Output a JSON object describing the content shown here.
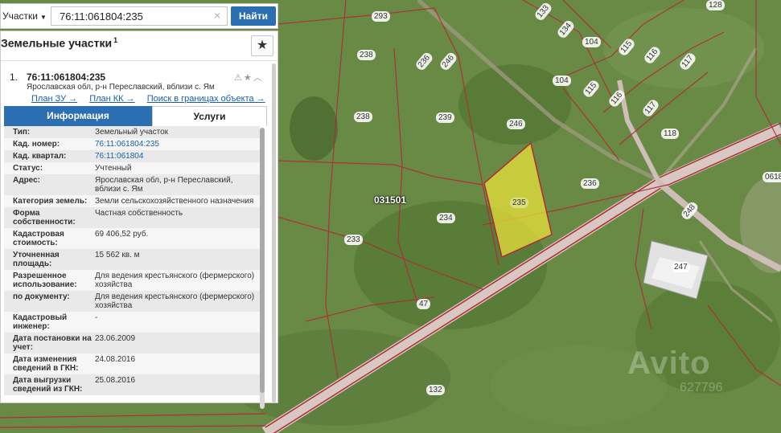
{
  "search": {
    "type_label": "Участки",
    "query": "76:11:061804:235",
    "clear_symbol": "×",
    "button_label": "Найти"
  },
  "panel": {
    "title": "Земельные участки",
    "title_count": "1",
    "favorite_icon": "star-icon"
  },
  "result": {
    "number": "1.",
    "cadastral_number": "76:11:061804:235",
    "address": "Ярославская обл, р-н Переславский, вблизи с. Ям",
    "icons": [
      "warning-icon",
      "star-icon",
      "collapse-icon"
    ],
    "links": [
      "План ЗУ →",
      "План КК →",
      "Поиск в границах объекта →"
    ]
  },
  "tabs": {
    "info": "Информация",
    "services": "Услуги"
  },
  "info_rows": [
    {
      "key": "Тип:",
      "value": "Земельный участок"
    },
    {
      "key": "Кад. номер:",
      "value": "76:11:061804:235"
    },
    {
      "key": "Кад. квартал:",
      "value": "76:11:061804"
    },
    {
      "key": "Статус:",
      "value": "Учтенный"
    },
    {
      "key": "Адрес:",
      "value": "Ярославская обл, р-н Переславский, вблизи с. Ям"
    },
    {
      "key": "Категория земель:",
      "value": "Земли сельскохозяйственного назначения"
    },
    {
      "key": "Форма собственности:",
      "value": "Частная собственность"
    },
    {
      "key": "Кадастровая стоимость:",
      "value": "69 406,52 руб."
    },
    {
      "key": "Уточненная площадь:",
      "value": "15 562 кв. м"
    },
    {
      "key": "Разрешенное использование:",
      "value": "Для ведения крестьянского (фермерского) хозяйства"
    },
    {
      "key": "по документу:",
      "value": "Для ведения крестьянского (фермерского) хозяйства"
    },
    {
      "key": "Кадастровый инженер:",
      "value": "-"
    },
    {
      "key": "Дата постановки на учет:",
      "value": "23.06.2009"
    },
    {
      "key": "Дата изменения сведений в ГКН:",
      "value": "24.08.2016"
    },
    {
      "key": "Дата выгрузки сведений из ГКН:",
      "value": "25.08.2016"
    }
  ],
  "map": {
    "quarter_label": "031501",
    "selected_plot": "235",
    "plot_labels": [
      "293",
      "133",
      "134",
      "128",
      "238",
      "236",
      "246",
      "104",
      "115",
      "116",
      "117",
      "239",
      "246",
      "104",
      "115",
      "116",
      "117",
      "118",
      "238",
      "236",
      "234",
      "233",
      "248",
      "247",
      "47",
      "132",
      "0618"
    ],
    "watermark": "Avito",
    "watermark_sub": "627796",
    "colors": {
      "selected_fill": "#e8e03a",
      "boundary": "#b02b3a",
      "road": "#c9a9a9"
    }
  }
}
